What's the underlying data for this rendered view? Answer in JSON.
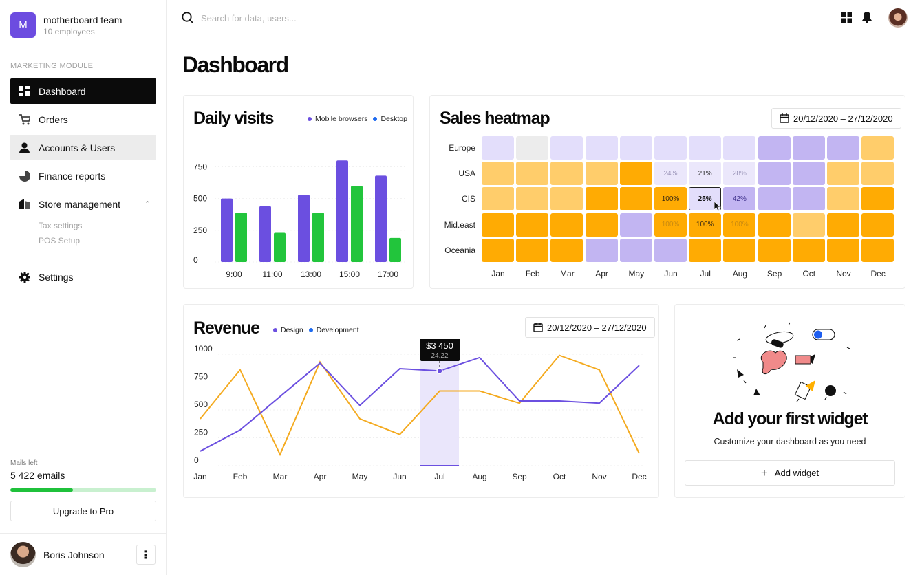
{
  "team": {
    "initial": "M",
    "name": "motherboard team",
    "employees": "10 employees"
  },
  "sidebar": {
    "section_label": "MARKETING MODULE",
    "items": [
      {
        "label": "Dashboard",
        "icon": "dashboard-icon"
      },
      {
        "label": "Orders",
        "icon": "cart-icon"
      },
      {
        "label": "Accounts & Users",
        "icon": "user-icon"
      },
      {
        "label": "Finance reports",
        "icon": "pie-chart-icon"
      },
      {
        "label": "Store management",
        "icon": "store-icon"
      },
      {
        "label": "Settings",
        "icon": "gear-icon"
      }
    ],
    "subitems": [
      "Tax settings",
      "POS Setup"
    ],
    "mails_label": "Mails left",
    "mails_count": "5 422 emails",
    "mails_progress": 0.43,
    "upgrade_label": "Upgrade to Pro"
  },
  "user": {
    "name": "Boris Johnson"
  },
  "search": {
    "placeholder": "Search for data, users..."
  },
  "page_title": "Dashboard",
  "colors": {
    "accent_purple": "#6b4fe0",
    "green": "#22c53c",
    "orange": "#ffaa00"
  },
  "daily_visits": {
    "title": "Daily visits",
    "legend": [
      "Mobile browsers",
      "Desktop"
    ],
    "chart_data": {
      "type": "bar",
      "categories": [
        "9:00",
        "11:00",
        "13:00",
        "15:00",
        "17:00"
      ],
      "series": [
        {
          "name": "Mobile browsers",
          "values": [
            500,
            440,
            530,
            800,
            680
          ],
          "color": "#6b4fe0"
        },
        {
          "name": "Desktop",
          "values": [
            390,
            230,
            390,
            600,
            190
          ],
          "color": "#22c53c"
        }
      ],
      "yticks": [
        0,
        250,
        500,
        750
      ],
      "ylim": [
        0,
        850
      ]
    }
  },
  "heatmap": {
    "title": "Sales heatmap",
    "date_range": "20/12/2020 – 27/12/2020",
    "rows": [
      "Europe",
      "USA",
      "CIS",
      "Mid.east",
      "Oceania"
    ],
    "cols": [
      "Jan",
      "Feb",
      "Mar",
      "Apr",
      "May",
      "Jun",
      "Jul",
      "Aug",
      "Sep",
      "Oct",
      "Nov",
      "Dec"
    ],
    "cells": [
      [
        "l2",
        "g",
        "l2",
        "l2",
        "l2",
        "l2",
        "l2",
        "l2",
        "p",
        "p",
        "p",
        "o2"
      ],
      [
        "o2",
        "o2",
        "o2",
        "o2",
        "o1",
        "t",
        "t",
        "t",
        "p",
        "p",
        "o2",
        "o2"
      ],
      [
        "o2",
        "o2",
        "o2",
        "o1",
        "o1",
        "o1",
        "sel",
        "p",
        "p",
        "p",
        "o2",
        "o1"
      ],
      [
        "o1",
        "o1",
        "o1",
        "o1",
        "p",
        "o1",
        "o1",
        "o1",
        "o1",
        "o2",
        "o1",
        "o1"
      ],
      [
        "o1",
        "o1",
        "o1",
        "p",
        "p",
        "p",
        "o1",
        "o1",
        "o1",
        "o1",
        "o1",
        "o1"
      ]
    ],
    "labels": [
      [
        "",
        "",
        "",
        "",
        "",
        "",
        "",
        "",
        "",
        "",
        "",
        ""
      ],
      [
        "",
        "",
        "",
        "",
        "",
        "24%",
        "21%",
        "28%",
        "",
        "",
        "",
        ""
      ],
      [
        "",
        "",
        "",
        "",
        "",
        "100%",
        "25%",
        "42%",
        "",
        "",
        "",
        ""
      ],
      [
        "",
        "",
        "",
        "",
        "",
        "100%",
        "100%",
        "100%",
        "",
        "",
        "",
        ""
      ],
      [
        "",
        "",
        "",
        "",
        "",
        "",
        "",
        "",
        "",
        "",
        "",
        ""
      ]
    ],
    "palette": {
      "l2": "#e3defb",
      "g": "#ececec",
      "p": "#c2b5f2",
      "o1": "#ffab03",
      "o2": "#ffcd6b",
      "t": "#ebe7fb",
      "sel": "#e3defb"
    }
  },
  "revenue": {
    "title": "Revenue",
    "legend": [
      "Design",
      "Development"
    ],
    "date_range": "20/12/2020 – 27/12/2020",
    "tooltip": {
      "value": "$3 450",
      "sub": "24.22"
    },
    "chart_data": {
      "type": "line",
      "categories": [
        "Jan",
        "Feb",
        "Mar",
        "Apr",
        "May",
        "Jun",
        "Jul",
        "Aug",
        "Sep",
        "Oct",
        "Nov",
        "Dec"
      ],
      "series": [
        {
          "name": "Design",
          "values": [
            130,
            320,
            620,
            920,
            540,
            870,
            850,
            970,
            580,
            580,
            560,
            900
          ],
          "color": "#6b4fe0"
        },
        {
          "name": "Development",
          "values": [
            420,
            860,
            100,
            930,
            420,
            280,
            670,
            670,
            560,
            990,
            860,
            110
          ],
          "color": "#f4aa1f"
        }
      ],
      "yticks": [
        0,
        250,
        500,
        750,
        1000
      ],
      "ylim": [
        0,
        1050
      ],
      "highlight": "Jul"
    }
  },
  "widget": {
    "title": "Add your first widget",
    "subtitle": "Customize your dashboard as you need",
    "button": "Add widget"
  }
}
